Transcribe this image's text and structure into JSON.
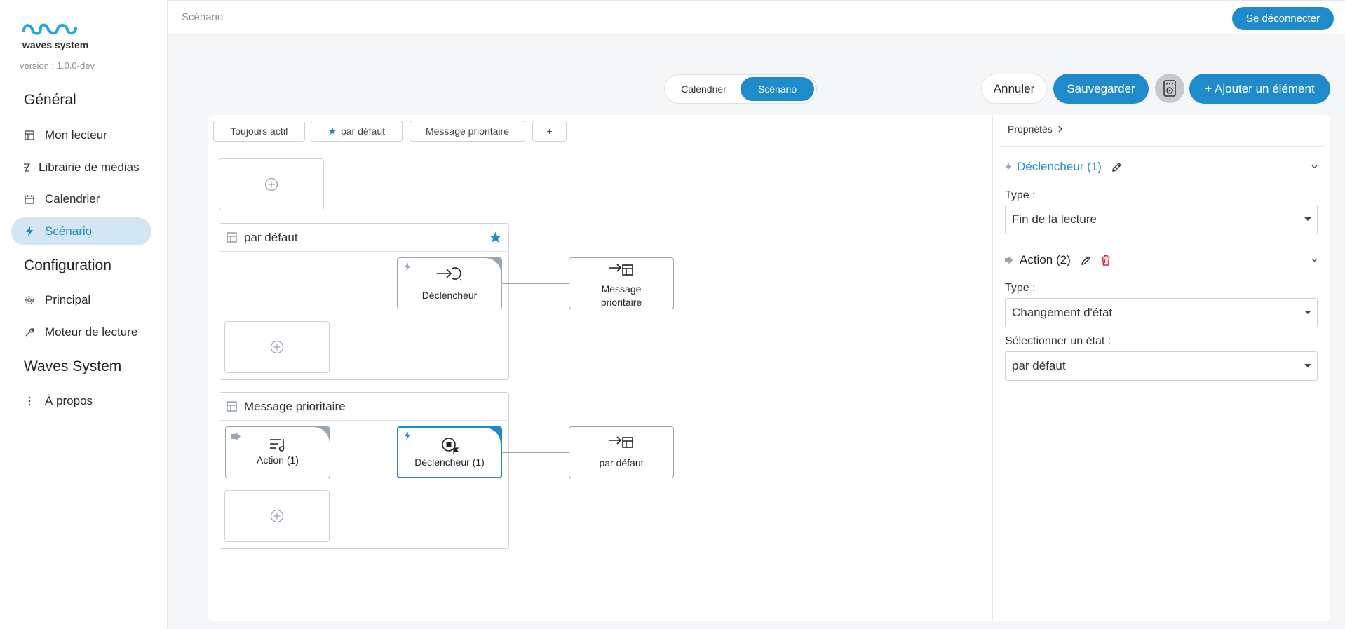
{
  "app": {
    "logo_text": "waves system",
    "version": "version : 1.0.0-dev"
  },
  "sidebar": {
    "sections": [
      {
        "title": "Général",
        "items": [
          {
            "label": "Mon lecteur",
            "icon": "layout-icon"
          },
          {
            "label": "Librairie de médias",
            "icon": "media-library-icon"
          },
          {
            "label": "Calendrier",
            "icon": "calendar-icon"
          },
          {
            "label": "Scénario",
            "icon": "lightning-icon",
            "active": true
          }
        ]
      },
      {
        "title": "Configuration",
        "items": [
          {
            "label": "Principal",
            "icon": "gear-icon"
          },
          {
            "label": "Moteur de lecture",
            "icon": "wrench-icon"
          }
        ]
      },
      {
        "title": "Waves System",
        "items": [
          {
            "label": "À propos",
            "icon": "vertical-dots-icon"
          }
        ]
      }
    ]
  },
  "topbar": {
    "breadcrumb": "Scénario",
    "logout_label": "Se déconnecter"
  },
  "view_toggle": {
    "options": [
      "Calendrier",
      "Scénario"
    ],
    "selected": "Scénario"
  },
  "toolbar": {
    "cancel_label": "Annuler",
    "save_label": "Sauvegarder",
    "player_icon": "speaker-icon",
    "add_label": "+ Ajouter un élément"
  },
  "state_tabs": [
    {
      "label": "Toujours actif"
    },
    {
      "label": "par défaut",
      "icon": "star-icon"
    },
    {
      "label": "Message prioritaire"
    },
    {
      "label": "+"
    }
  ],
  "canvas": {
    "states": [
      {
        "name": "par défaut",
        "starred": true,
        "nodes": [
          {
            "type": "trigger",
            "label": "Déclencheur",
            "target": "Message prioritaire"
          }
        ]
      },
      {
        "name": "Message prioritaire",
        "starred": false,
        "nodes": [
          {
            "type": "action",
            "label": "Action (1)"
          },
          {
            "type": "trigger",
            "label": "Déclencheur (1)",
            "selected": true,
            "target": "par défaut"
          }
        ]
      }
    ],
    "targets": {
      "first_line1": "Message",
      "first_line2": "prioritaire",
      "second": "par défaut"
    }
  },
  "properties": {
    "title": "Propriétés",
    "trigger": {
      "header": "Déclencheur (1)",
      "type_label": "Type :",
      "type_value": "Fin de la lecture"
    },
    "action": {
      "header": "Action (2)",
      "type_label": "Type :",
      "type_value": "Changement d'état",
      "state_label": "Sélectionner un état :",
      "state_value": "par défaut"
    }
  },
  "colors": {
    "accent": "#1f8bcb",
    "active_bg": "#d2e6f4",
    "node_border": "#9aa4b2",
    "delete": "#e0262e"
  }
}
